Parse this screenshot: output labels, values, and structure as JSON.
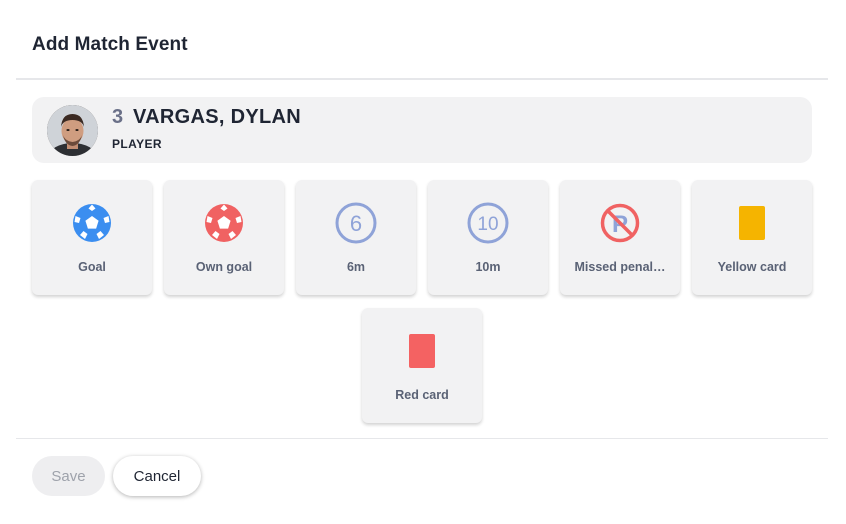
{
  "dialog": {
    "title": "Add Match Event"
  },
  "player": {
    "number": "3",
    "name": "VARGAS, DYLAN",
    "role": "PLAYER"
  },
  "events": [
    {
      "label": "Goal",
      "icon": "soccer-ball-icon",
      "color": "#3b8ef0"
    },
    {
      "label": "Own goal",
      "icon": "soccer-ball-icon",
      "color": "#f06262"
    },
    {
      "label": "6m",
      "icon": "circle-6-icon",
      "number": "6",
      "color": "#8fa3d8"
    },
    {
      "label": "10m",
      "icon": "circle-10-icon",
      "number": "10",
      "color": "#8fa3d8"
    },
    {
      "label": "Missed penal…",
      "icon": "missed-penalty-icon",
      "letter": "P",
      "color": "#f06262"
    },
    {
      "label": "Yellow card",
      "icon": "yellow-card-icon",
      "color": "#f5b400"
    },
    {
      "label": "Red card",
      "icon": "red-card-icon",
      "color": "#f46262"
    }
  ],
  "footer": {
    "save_label": "Save",
    "cancel_label": "Cancel"
  }
}
